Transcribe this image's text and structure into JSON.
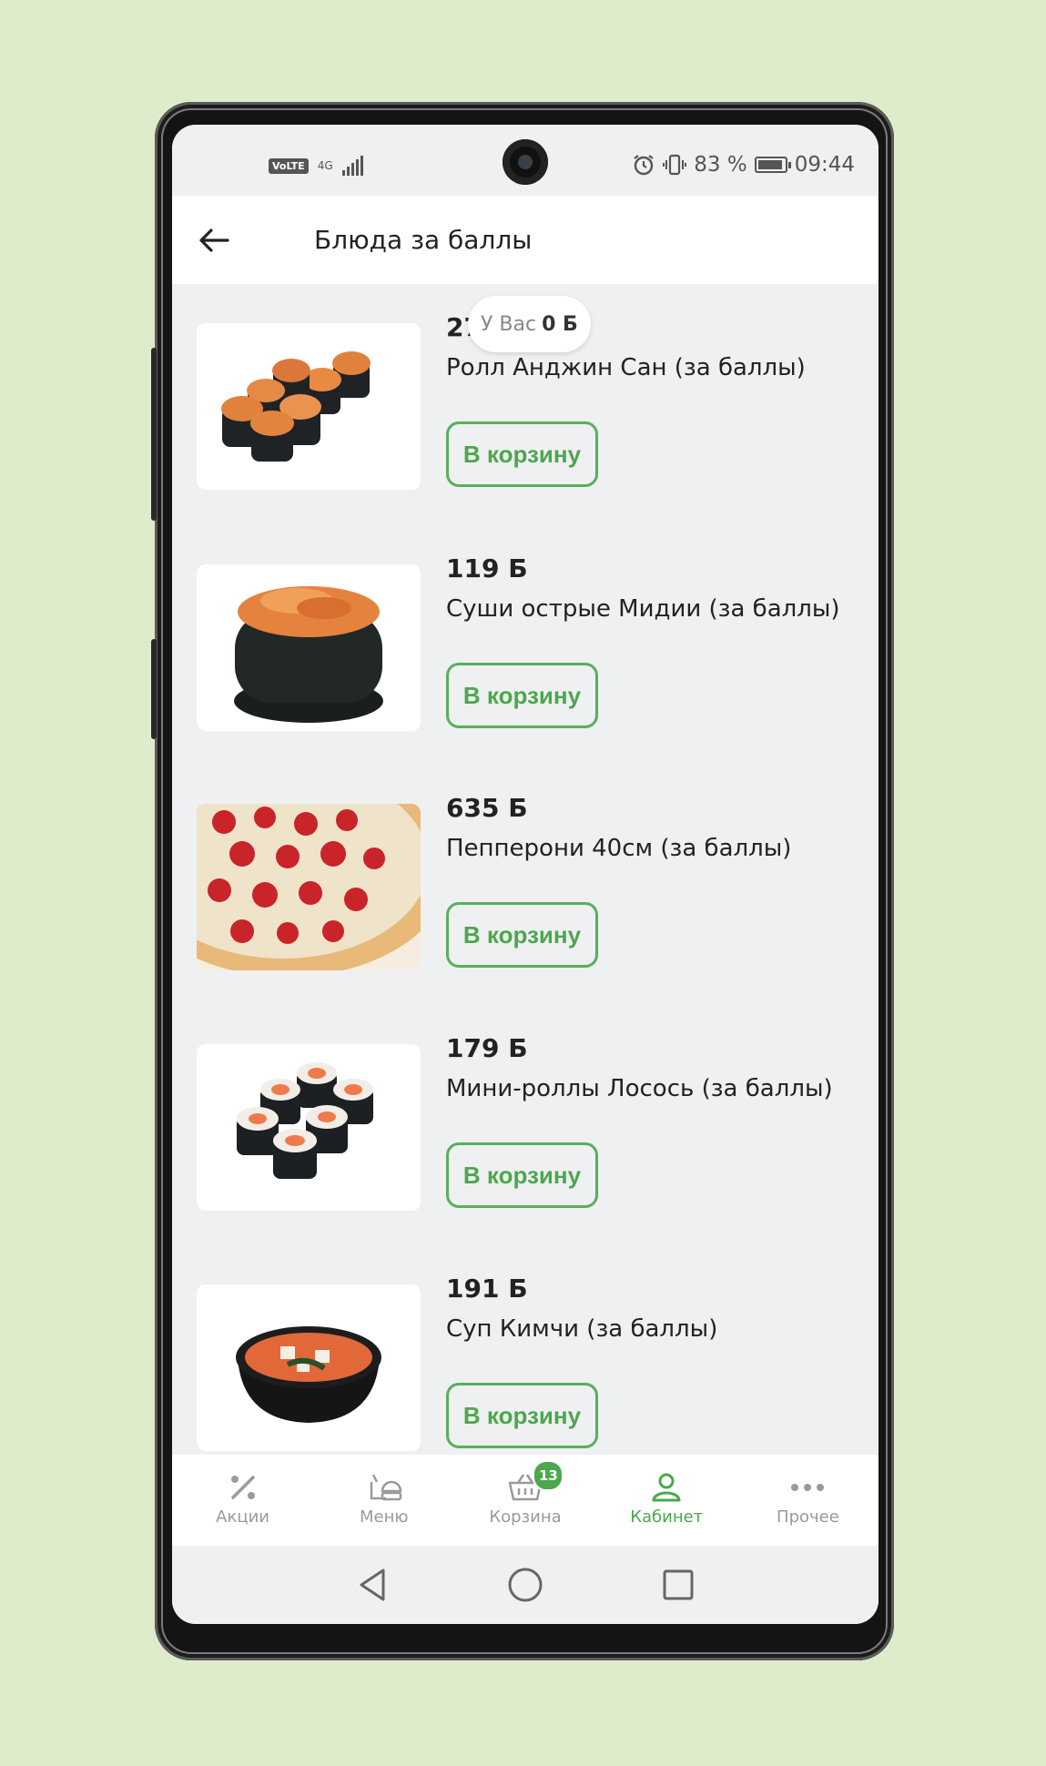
{
  "status_bar": {
    "volte": "VoLTE",
    "network": "4G",
    "battery_percent": "83 %",
    "time": "09:44"
  },
  "header": {
    "title": "Блюда за баллы"
  },
  "balance": {
    "prefix": "У Вас",
    "value": "0 Б"
  },
  "products": [
    {
      "price": "27",
      "name": "Ролл Анджин Сан (за баллы)",
      "button": "В корзину",
      "image": "sushi-rolls-baked"
    },
    {
      "price": "119 Б",
      "name": "Суши острые Мидии (за баллы)",
      "button": "В корзину",
      "image": "gunkan-sushi"
    },
    {
      "price": "635 Б",
      "name": "Пепперони 40см (за баллы)",
      "button": "В корзину",
      "image": "pepperoni-pizza"
    },
    {
      "price": "179 Б",
      "name": "Мини-роллы Лосось (за баллы)",
      "button": "В корзину",
      "image": "salmon-maki"
    },
    {
      "price": "191 Б",
      "name": "Суп Кимчи (за баллы)",
      "button": "В корзину",
      "image": "kimchi-soup"
    }
  ],
  "tabs": [
    {
      "label": "Акции",
      "icon": "percent-icon"
    },
    {
      "label": "Меню",
      "icon": "menu-food-icon"
    },
    {
      "label": "Корзина",
      "icon": "basket-icon",
      "badge": "13"
    },
    {
      "label": "Кабинет",
      "icon": "user-icon",
      "active": true
    },
    {
      "label": "Прочее",
      "icon": "more-icon"
    }
  ],
  "colors": {
    "accent": "#4ca74d",
    "background": "#dfeccb",
    "screen": "#eff0f2"
  }
}
